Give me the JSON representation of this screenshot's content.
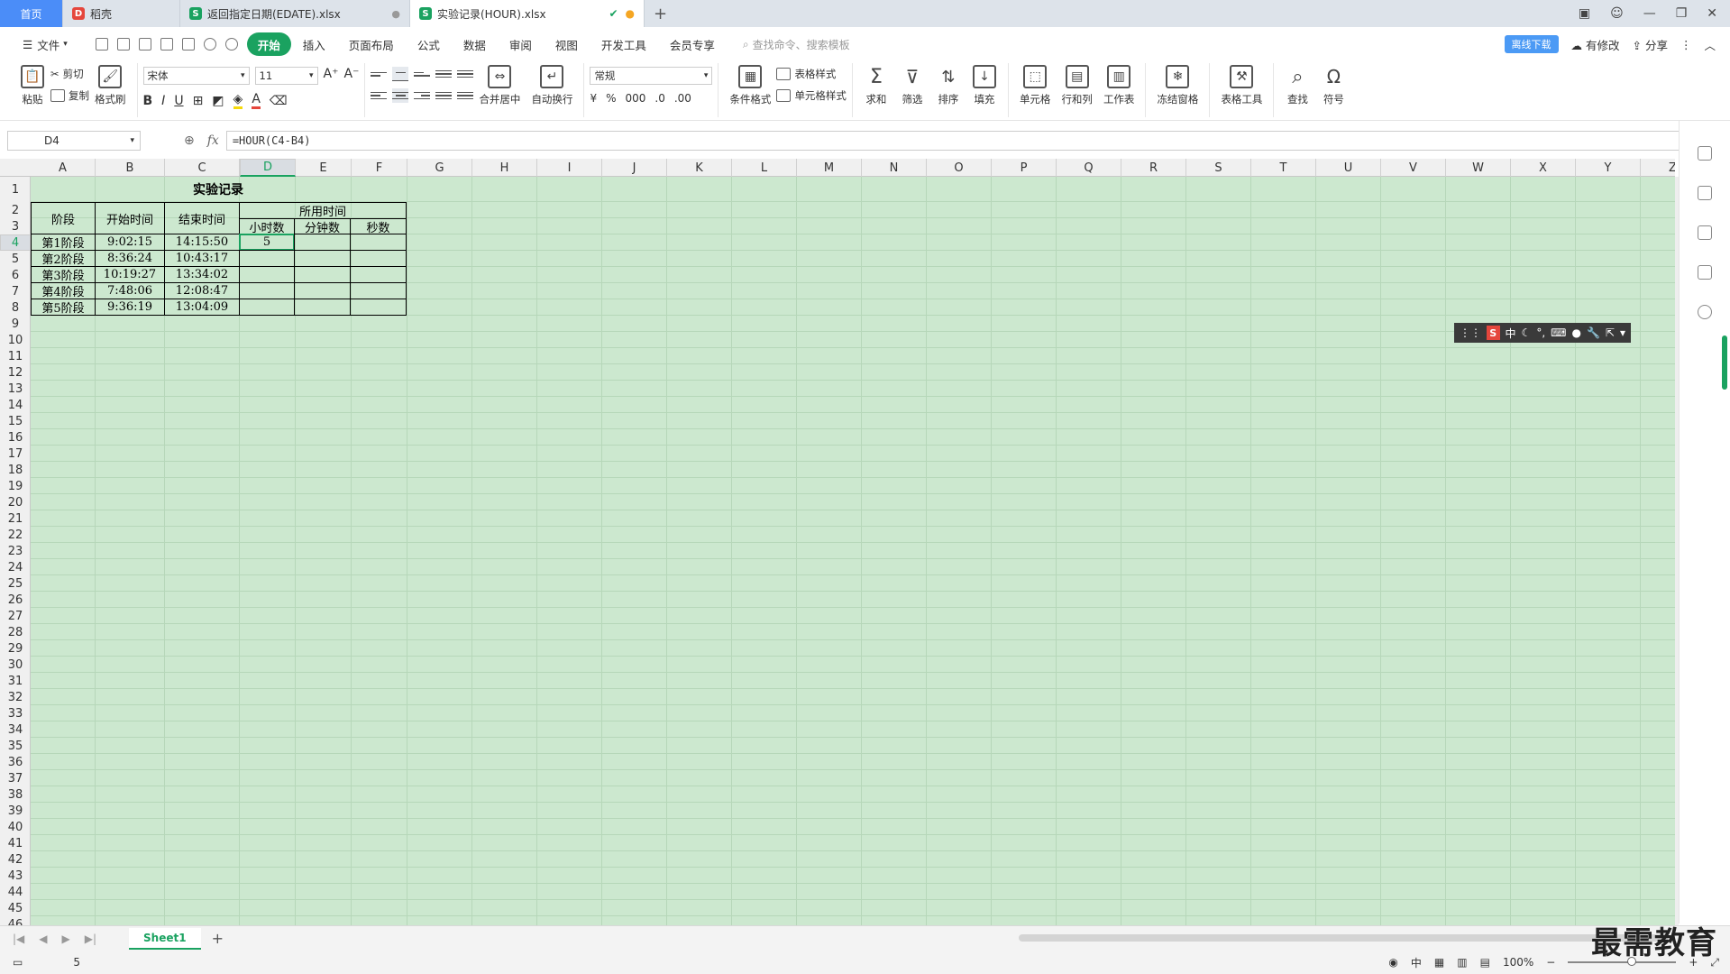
{
  "tabs": {
    "home": "首页",
    "t1": "稻壳",
    "t2": "返回指定日期(EDATE).xlsx",
    "t3": "实验记录(HOUR).xlsx"
  },
  "menu": {
    "file": "文件",
    "items": [
      "开始",
      "插入",
      "页面布局",
      "公式",
      "数据",
      "审阅",
      "视图",
      "开发工具",
      "会员专享"
    ],
    "search": "查找命令、搜索模板",
    "cloud": "有修改",
    "share": "分享",
    "badge": "离线下载"
  },
  "ribbon": {
    "paste": "粘贴",
    "cut": "剪切",
    "copy": "复制",
    "format_painter": "格式刷",
    "font_name": "宋体",
    "font_size": "11",
    "merge": "合并居中",
    "wrap": "自动换行",
    "number_format": "常规",
    "table_style": "表格样式",
    "cond_format": "条件格式",
    "cell_style": "单元格样式",
    "sum": "求和",
    "filter": "筛选",
    "sort": "排序",
    "fill": "填充",
    "cell": "单元格",
    "rowcol": "行和列",
    "sheet": "工作表",
    "freeze": "冻结窗格",
    "tools": "表格工具",
    "find": "查找",
    "symbol": "符号"
  },
  "formula_bar": {
    "cell_ref": "D4",
    "formula": "=HOUR(C4-B4)"
  },
  "columns": [
    "A",
    "B",
    "C",
    "D",
    "E",
    "F",
    "G",
    "H",
    "I",
    "J",
    "K",
    "L",
    "M",
    "N",
    "O",
    "P",
    "Q",
    "R",
    "S",
    "T",
    "U",
    "V",
    "W",
    "X",
    "Y",
    "Z"
  ],
  "table": {
    "title": "实验记录",
    "h_stage": "阶段",
    "h_start": "开始时间",
    "h_end": "结束时间",
    "h_used": "所用时间",
    "h_hours": "小时数",
    "h_minutes": "分钟数",
    "h_seconds": "秒数",
    "rows": [
      {
        "stage": "第1阶段",
        "start": "9:02:15",
        "end": "14:15:50",
        "hours": "5"
      },
      {
        "stage": "第2阶段",
        "start": "8:36:24",
        "end": "10:43:17",
        "hours": ""
      },
      {
        "stage": "第3阶段",
        "start": "10:19:27",
        "end": "13:34:02",
        "hours": ""
      },
      {
        "stage": "第4阶段",
        "start": "7:48:06",
        "end": "12:08:47",
        "hours": ""
      },
      {
        "stage": "第5阶段",
        "start": "9:36:19",
        "end": "13:04:09",
        "hours": ""
      }
    ]
  },
  "ime": {
    "s": "S",
    "lang": "中"
  },
  "sheet_tab": "Sheet1",
  "status": {
    "value": "5",
    "zoom": "100%",
    "lang": "中"
  },
  "watermark": "最需教育"
}
